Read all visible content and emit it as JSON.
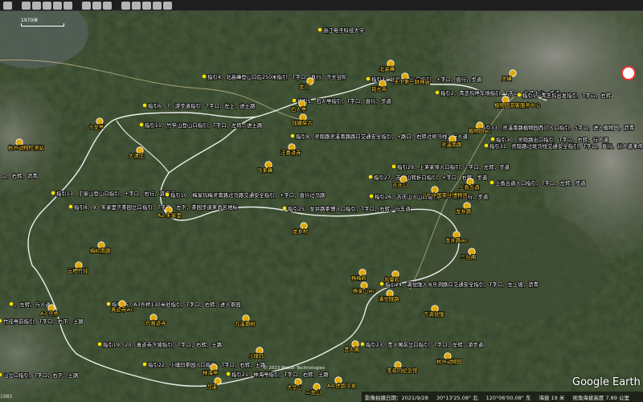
{
  "app": {
    "name": "Google Earth"
  },
  "scale_label": "1970米",
  "copyright": "© 2023 Maxar Technologies",
  "year_label": "1985",
  "status": {
    "imagery_date": "影像拍摄日期：2021/9/28",
    "lat": "30°13'25.08\" 北",
    "lon": "120°06'00.08\" 东",
    "elevation": "海拔 19 米",
    "eye_alt": "视角海拔高度 7.89 公里"
  },
  "labels": [
    {
      "id": "l1",
      "text": "浙江电子科技大学"
    },
    {
      "id": "l2",
      "text": "指引4、北高峰登山口后250米指引，T字口，直行，下长台阶"
    },
    {
      "id": "l3",
      "text": "指引3、北高峰登山口指引，+字口，直行，步道"
    },
    {
      "id": "l4",
      "text": "指引2、青芝坞停车场指引，T字口，左转上山，步道"
    },
    {
      "id": "l5",
      "text": "指引1、青芝坞出发指引，T字口，右转"
    },
    {
      "id": "l6",
      "text": "指引5、石人亭指引，T字口，直行，步道"
    },
    {
      "id": "l7",
      "text": "指引6、7、游步道指引，T字口，左上，进土路"
    },
    {
      "id": "l8",
      "text": "指引11、竹竿山登山口指引，T字口，左转，进土路"
    },
    {
      "id": "l9",
      "text": "指引33、灵溪南路植物园西门入口指引，5字口，进入植物园，沥青"
    },
    {
      "id": "l10",
      "text": "指引8、灵隐路灵溪南路路口交通安全指引，+路口，右转过斑马线，行人道"
    },
    {
      "id": "l11",
      "text": "指引30、灵隐路出口指引，T字口，右转，行人道"
    },
    {
      "id": "l12",
      "text": "指引31、灵隐路过斑马线交通安全指引，T字口，直行，行人道来命名地标"
    },
    {
      "id": "l13",
      "text": "指引29、上茅家埠入口指引，T字口，左转，步道"
    },
    {
      "id": "l14",
      "text": "指引27、吉庆山转折口指引，+字口，右转，步道"
    },
    {
      "id": "l15",
      "text": "指引26、吉庆山入山口指引，+字口，直行，步道"
    },
    {
      "id": "l16",
      "text": "上香古道入口指引，T字口，左转，步道"
    },
    {
      "id": "l17",
      "text": "指引13、丁家山登山口指引，+字口，右行，游步道"
    },
    {
      "id": "l18",
      "text": "指引10、梅家坞梅灵南路过马路交通安全指引，+字口，直行过马路"
    },
    {
      "id": "l19",
      "text": "指引8、9、朱家里下茶园岔口指引，T字口，左下，茶园步道来命名地标"
    },
    {
      "id": "l20",
      "text": "指引25、龙井路茶博入口指引，T字口，右转，行车道"
    },
    {
      "id": "l21",
      "text": "指引24、满觉陇入水乐洞路口交通安全指引，T字口，左上坡，沥青"
    },
    {
      "id": "l22",
      "text": "指引15、A3外桥130米处指引，T字口，右转，进入茶园"
    },
    {
      "id": "l23",
      "text": "，左转，行人道"
    },
    {
      "id": "l24",
      "text": "竹径亭前指引，T字口，右下，土路"
    },
    {
      "id": "l25",
      "text": "指引19、20、真迹寺下坡指引，T字口，右转，土路"
    },
    {
      "id": "l26",
      "text": "指引23、贵人阁前岔口指引，T字口，左转，游步道"
    },
    {
      "id": "l27",
      "text": "指引22、小璞玛茶园入口指引，T字口，右转，土路"
    },
    {
      "id": "l28",
      "text": "指引21、林海亭指引，T字口，右转，土路"
    },
    {
      "id": "l29",
      "text": "山岔口指引，T字口，右下，土路"
    },
    {
      "id": "l30",
      "text": "口，右转，沥青"
    }
  ],
  "pois": [
    {
      "id": "p1",
      "text": "北高峰"
    },
    {
      "id": "p2",
      "text": "天下第一财神庙"
    },
    {
      "id": "p3",
      "text": "灵峰"
    },
    {
      "id": "p4",
      "text": "植物园游客服务中心"
    },
    {
      "id": "p5",
      "text": "植物园wc"
    },
    {
      "id": "p6",
      "text": "龙门"
    },
    {
      "id": "p7",
      "text": "石人亭"
    },
    {
      "id": "p8",
      "text": "钱塘探古"
    },
    {
      "id": "p9",
      "text": "韬光寺"
    },
    {
      "id": "p10",
      "text": "法喜讲寺"
    },
    {
      "id": "p11",
      "text": "灵溪南路"
    },
    {
      "id": "p12",
      "text": "十龙亭"
    },
    {
      "id": "p13",
      "text": "杭州动物检测站"
    },
    {
      "id": "p14",
      "text": "大清庄"
    },
    {
      "id": "p15",
      "text": "飞来峰"
    },
    {
      "id": "p16",
      "text": "吉庆山"
    },
    {
      "id": "p17",
      "text": "上香古道"
    },
    {
      "id": "p18",
      "text": "SP 中国茶叶博物馆"
    },
    {
      "id": "p19",
      "text": "龙井村"
    },
    {
      "id": "p20",
      "text": "龙井路"
    },
    {
      "id": "p21",
      "text": "龙井路wc"
    },
    {
      "id": "p22",
      "text": "A2 朱家里"
    },
    {
      "id": "p23",
      "text": "梅岭南路"
    },
    {
      "id": "p24",
      "text": "三台阁"
    },
    {
      "id": "p25",
      "text": "风篁岭"
    },
    {
      "id": "p26",
      "text": "杨梅岭"
    },
    {
      "id": "p27",
      "text": "满觉陇路"
    },
    {
      "id": "p28",
      "text": "杨家山wc"
    },
    {
      "id": "p29",
      "text": "云栖竹径"
    },
    {
      "id": "p30",
      "text": "A3 外桥"
    },
    {
      "id": "p31",
      "text": "真迹寺wc"
    },
    {
      "id": "p32",
      "text": "CP 真迹寺"
    },
    {
      "id": "p33",
      "text": "下满觉陇"
    },
    {
      "id": "p34",
      "text": "九溪烟树"
    },
    {
      "id": "p35",
      "text": "贵人阁"
    },
    {
      "id": "p36",
      "text": "小璞玛"
    },
    {
      "id": "p37",
      "text": "林海亭"
    },
    {
      "id": "p38",
      "text": "九溪"
    },
    {
      "id": "p39",
      "text": "杭州动物园"
    },
    {
      "id": "p40",
      "text": "李叔同纪念馆"
    },
    {
      "id": "p41",
      "text": "大华山"
    },
    {
      "id": "p42",
      "text": "A4 虎跑冷泉"
    },
    {
      "id": "p43",
      "text": "二龙山"
    }
  ],
  "colors": {
    "route": "#ffffff",
    "pin": "#e0a800",
    "poi_text": "#ffd93a"
  }
}
